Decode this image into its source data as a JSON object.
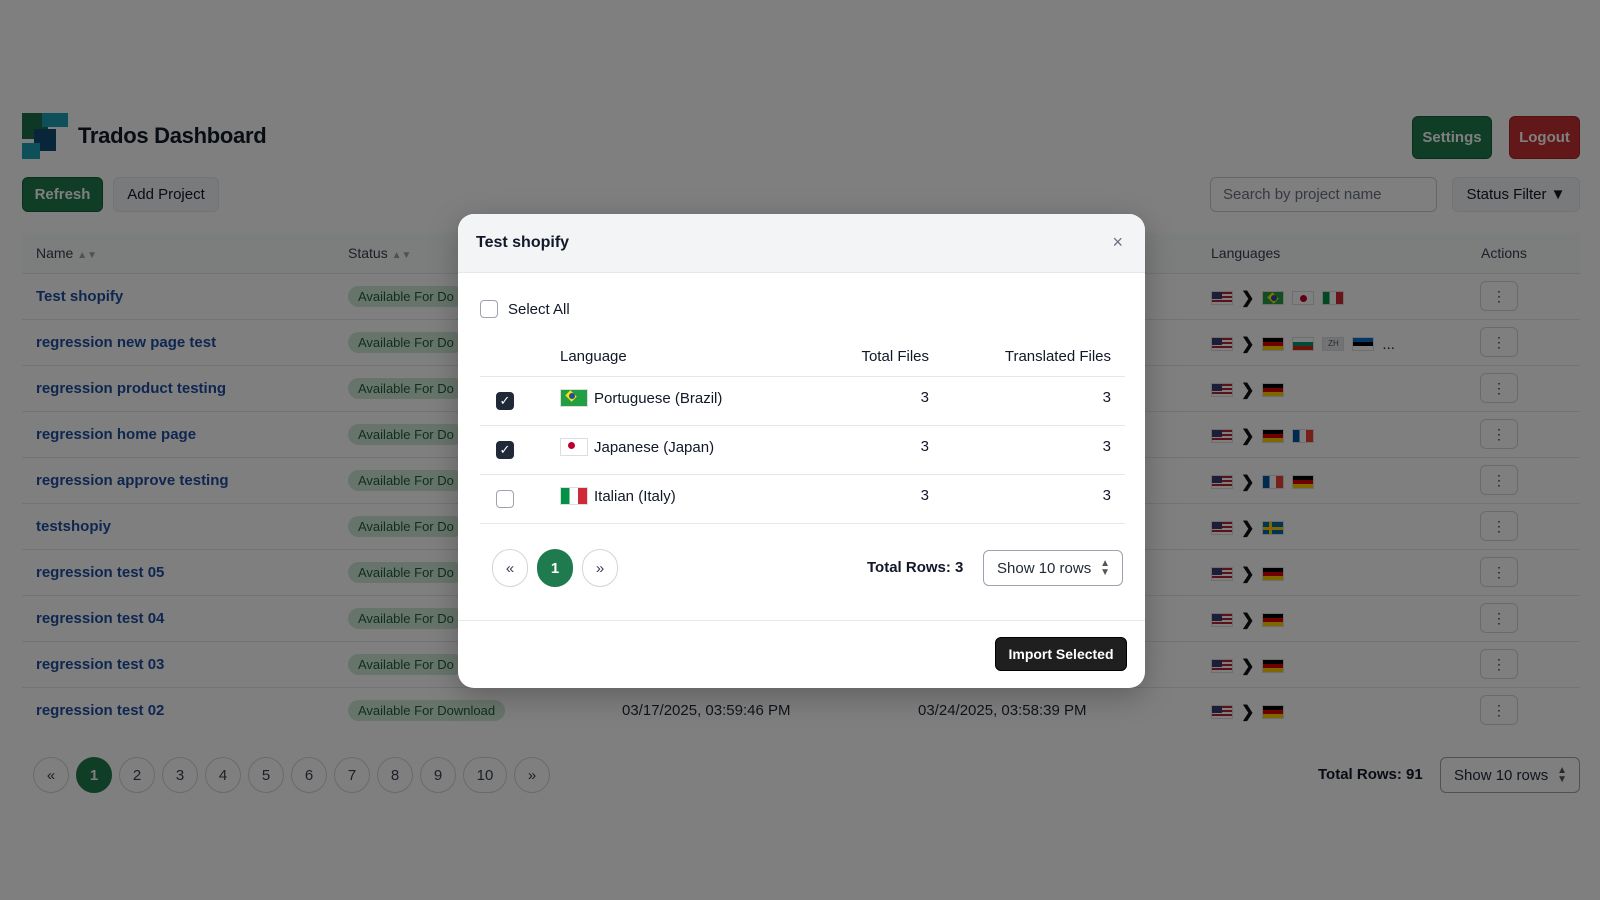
{
  "header": {
    "title": "Trados Dashboard",
    "settings_label": "Settings",
    "logout_label": "Logout"
  },
  "toolbar": {
    "refresh_label": "Refresh",
    "add_project_label": "Add Project",
    "search_placeholder": "Search by project name",
    "status_filter_label": "Status Filter ▼"
  },
  "table": {
    "columns": {
      "name": "Name",
      "status": "Status",
      "languages": "Languages",
      "actions": "Actions"
    },
    "rows": [
      {
        "name": "Test shopify",
        "status": "Available For Do",
        "created": "",
        "due": "",
        "source": "us",
        "targets": [
          "br",
          "jp",
          "it"
        ]
      },
      {
        "name": "regression new page test",
        "status": "Available For Do",
        "created": "",
        "due": "",
        "source": "us",
        "targets": [
          "de",
          "bg",
          "zh",
          "ee"
        ],
        "more": "..."
      },
      {
        "name": "regression product testing",
        "status": "Available For Do",
        "created": "",
        "due": "",
        "source": "us",
        "targets": [
          "de"
        ]
      },
      {
        "name": "regression home page",
        "status": "Available For Do",
        "created": "",
        "due": "",
        "source": "us",
        "targets": [
          "de",
          "fr"
        ]
      },
      {
        "name": "regression approve testing",
        "status": "Available For Do",
        "created": "",
        "due": "",
        "source": "us",
        "targets": [
          "fr",
          "de"
        ]
      },
      {
        "name": "testshopiy",
        "status": "Available For Do",
        "created": "",
        "due": "",
        "source": "us",
        "targets": [
          "se"
        ]
      },
      {
        "name": "regression test 05",
        "status": "Available For Do",
        "created": "",
        "due": "",
        "source": "us",
        "targets": [
          "de"
        ]
      },
      {
        "name": "regression test 04",
        "status": "Available For Do",
        "created": "",
        "due": "",
        "source": "us",
        "targets": [
          "de"
        ]
      },
      {
        "name": "regression test 03",
        "status": "Available For Do",
        "created": "",
        "due": "",
        "source": "us",
        "targets": [
          "de"
        ]
      },
      {
        "name": "regression test 02",
        "status": "Available For Download",
        "created": "03/17/2025, 03:59:46 PM",
        "due": "03/24/2025, 03:58:39 PM",
        "source": "us",
        "targets": [
          "de"
        ]
      }
    ],
    "action_glyph": "⋮",
    "zh_label": "ZH",
    "chevron": "❯"
  },
  "pagination": {
    "prev": "«",
    "next": "»",
    "pages": [
      "1",
      "2",
      "3",
      "4",
      "5",
      "6",
      "7",
      "8",
      "9",
      "10"
    ],
    "active": "1",
    "total_rows": "Total Rows: 91",
    "show_rows": "Show 10 rows"
  },
  "modal": {
    "title": "Test shopify",
    "close": "×",
    "select_all": "Select All",
    "columns": {
      "language": "Language",
      "total_files": "Total Files",
      "translated_files": "Translated Files"
    },
    "rows": [
      {
        "flag": "br",
        "language": "Portuguese (Brazil)",
        "total": "3",
        "translated": "3",
        "checked": true
      },
      {
        "flag": "jp",
        "language": "Japanese (Japan)",
        "total": "3",
        "translated": "3",
        "checked": true
      },
      {
        "flag": "it",
        "language": "Italian (Italy)",
        "total": "3",
        "translated": "3",
        "checked": false
      }
    ],
    "pager": {
      "prev": "«",
      "page": "1",
      "next": "»"
    },
    "total_rows": "Total Rows: 3",
    "show_rows": "Show 10 rows",
    "import_label": "Import Selected",
    "check_glyph": "✓"
  },
  "colors": {
    "primary": "#1f7a4d",
    "danger": "#c53030",
    "link": "#1f4fa0",
    "badge_bg": "#cfe9d6"
  }
}
